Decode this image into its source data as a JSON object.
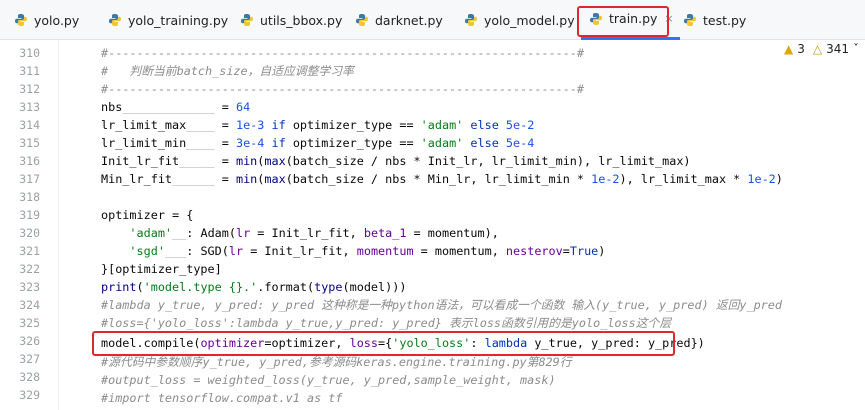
{
  "tabs": [
    {
      "label": "yolo.py",
      "active": false
    },
    {
      "label": "yolo_training.py",
      "active": false
    },
    {
      "label": "utils_bbox.py",
      "active": false
    },
    {
      "label": "darknet.py",
      "active": false
    },
    {
      "label": "yolo_model.py",
      "active": false
    },
    {
      "label": "train.py",
      "active": true
    },
    {
      "label": "test.py",
      "active": false
    }
  ],
  "tab_close_glyph": "×",
  "inspections": {
    "warnings": "3",
    "weak_warnings": "341",
    "more": "ˇ"
  },
  "line_numbers": [
    "310",
    "311",
    "312",
    "313",
    "314",
    "315",
    "316",
    "317",
    "318",
    "319",
    "320",
    "321",
    "322",
    "323",
    "324",
    "325",
    "326",
    "327",
    "328",
    "329"
  ],
  "code": {
    "l310": "#------------------------------------------------------------------#",
    "l311": "#   判断当前batch_size，自适应调整学习率",
    "l312": "#------------------------------------------------------------------#",
    "l313": [
      "nbs",
      "_____________",
      " = ",
      "64"
    ],
    "l314": [
      "lr_limit_max",
      "____",
      " = ",
      "1e-3",
      " if ",
      "optimizer_type == ",
      "'adam'",
      " else ",
      "5e-2"
    ],
    "l315": [
      "lr_limit_min",
      "____",
      " = ",
      "3e-4",
      " if ",
      "optimizer_type == ",
      "'adam'",
      " else ",
      "5e-4"
    ],
    "l316": [
      "Init_lr_fit",
      "_____",
      " = ",
      "min",
      "(",
      "max",
      "(batch_size / nbs * Init_lr, lr_limit_min), lr_limit_max)"
    ],
    "l317": [
      "Min_lr_fit",
      "______",
      " = ",
      "min",
      "(",
      "max",
      "(batch_size / nbs * Min_lr, lr_limit_min * ",
      "1e-2",
      "), lr_limit_max * ",
      "1e-2",
      ")"
    ],
    "l319": "optimizer = {",
    "l320": [
      "    ",
      "'adam'",
      "__",
      ": Adam(",
      "lr",
      " = ",
      "Init_lr_fit, ",
      "beta_1",
      " = ",
      "momentum),"
    ],
    "l321": [
      "    ",
      "'sgd'",
      "___",
      ": SGD(",
      "lr",
      " = ",
      "Init_lr_fit, ",
      "momentum",
      " = ",
      "momentum, ",
      "nesterov",
      "=",
      "True",
      ")"
    ],
    "l322": "}[optimizer_type]",
    "l323": [
      "print",
      "(",
      "'model.type {}.'",
      ".format(",
      "type",
      "(model)))"
    ],
    "l324": "#lambda y_true, y_pred: y_pred 这种称是一种python语法，可以看成一个函数 输入(y_true, y_pred) 返回y_pred",
    "l325": "#loss={'yolo_loss':lambda y_true,y_pred: y_pred} 表示loss函数引用的是yolo_loss这个层",
    "l326": [
      "model.compile(",
      "optimizer",
      "=optimizer, ",
      "loss",
      "={",
      "'yolo_loss'",
      ": ",
      "lambda",
      " y_true, y_pred: y_pred})"
    ],
    "l327": "#源代码中参数顺序y_true, y_pred,参考源码keras.engine.training.py第829行",
    "l328": "#output_loss = weighted_loss(y_true, y_pred,sample_weight, mask)",
    "l329": "#import tensorflow.compat.v1 as tf"
  }
}
